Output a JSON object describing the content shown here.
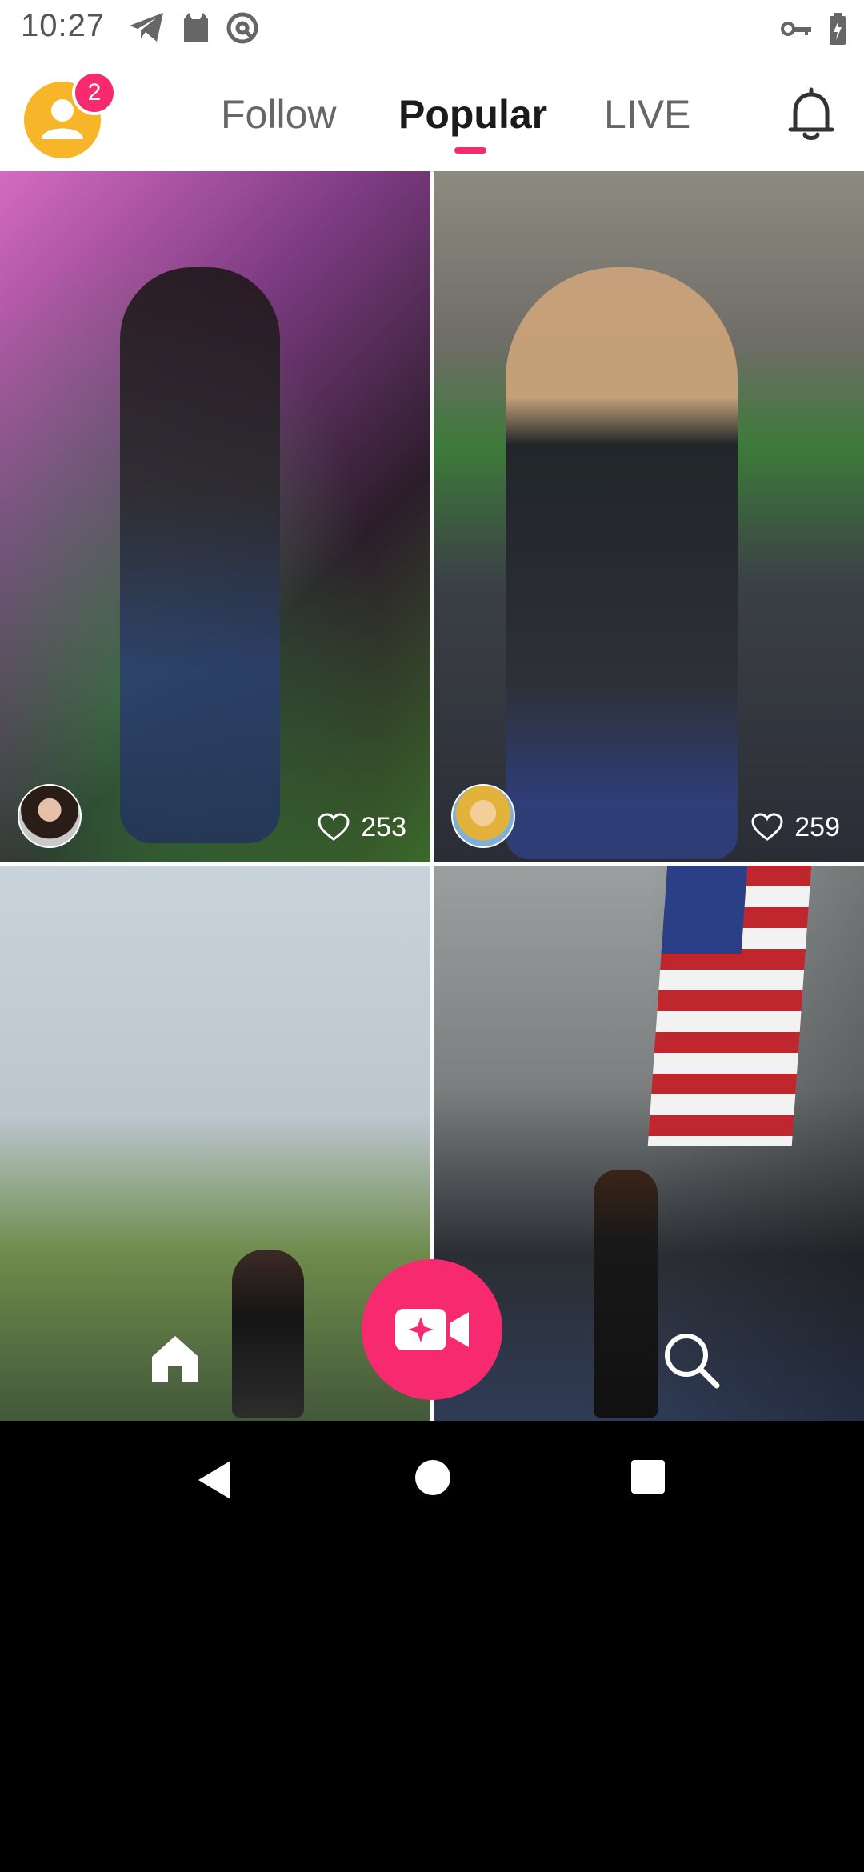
{
  "status_bar": {
    "time": "10:27",
    "left_icons": [
      "telegram-icon",
      "cat-icon",
      "at-sign-icon"
    ],
    "right_icons": [
      "key-icon",
      "battery-charging-icon"
    ]
  },
  "header": {
    "notification_count": "2",
    "tabs": [
      {
        "label": "Follow",
        "active": false
      },
      {
        "label": "Popular",
        "active": true
      },
      {
        "label": "LIVE",
        "active": false
      }
    ],
    "accent_color": "#F7296F"
  },
  "feed": {
    "cards": [
      {
        "likes": "253",
        "has_creator_avatar": true
      },
      {
        "likes": "259",
        "has_creator_avatar": true
      },
      {
        "likes": "",
        "has_creator_avatar": false
      },
      {
        "likes": "",
        "has_creator_avatar": false
      }
    ]
  },
  "bottom_nav": {
    "items": [
      "home-icon",
      "video-create-icon",
      "search-icon"
    ]
  },
  "android_nav": [
    "back-icon",
    "home-circle-icon",
    "recents-icon"
  ]
}
